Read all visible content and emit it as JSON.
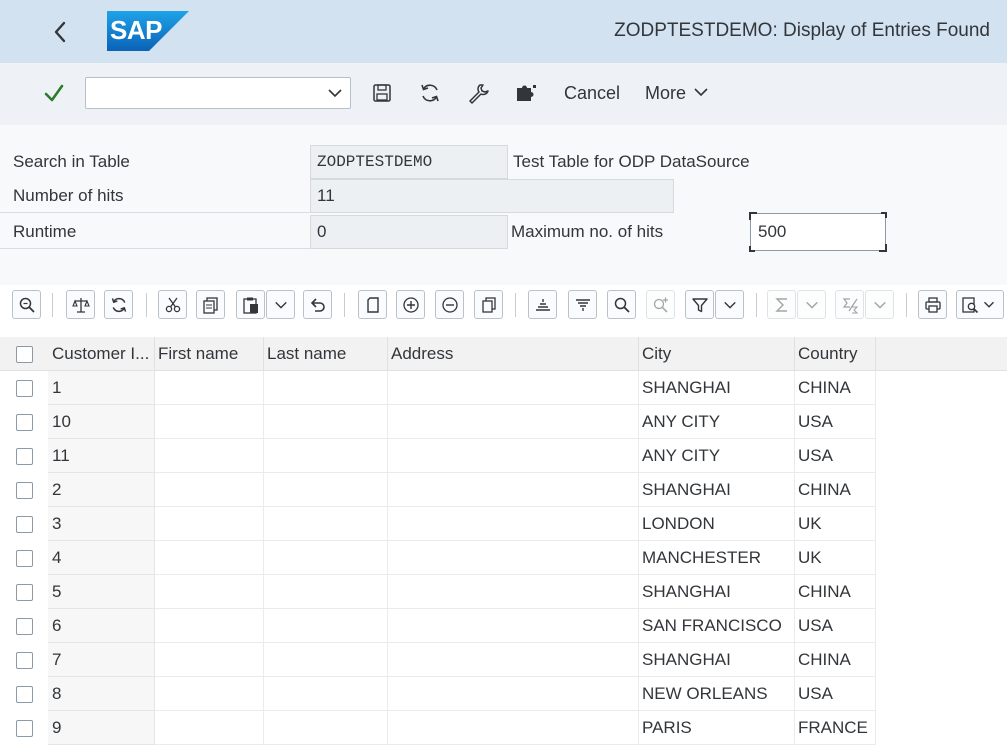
{
  "shell": {
    "title": "ZODPTESTDEMO: Display of Entries Found",
    "logo_text": "SAP"
  },
  "toolbar": {
    "command_value": "",
    "cancel_label": "Cancel",
    "more_label": "More"
  },
  "form": {
    "search_label": "Search in Table",
    "search_value": "ZODPTESTDEMO",
    "table_description": "Test Table for ODP DataSource",
    "hits_label": "Number of hits",
    "hits_value": "11",
    "runtime_label": "Runtime",
    "runtime_value": "0",
    "maxhits_label": "Maximum no. of hits",
    "maxhits_value": "500"
  },
  "grid": {
    "columns": [
      "Customer I...",
      "First name",
      "Last name",
      "Address",
      "City",
      "Country"
    ],
    "rows": [
      {
        "id": "1",
        "first": "",
        "last": "",
        "address": "",
        "city": "SHANGHAI",
        "country": "CHINA"
      },
      {
        "id": "10",
        "first": "",
        "last": "",
        "address": "",
        "city": "ANY CITY",
        "country": "USA"
      },
      {
        "id": "11",
        "first": "",
        "last": "",
        "address": "",
        "city": "ANY CITY",
        "country": "USA"
      },
      {
        "id": "2",
        "first": "",
        "last": "",
        "address": "",
        "city": "SHANGHAI",
        "country": "CHINA"
      },
      {
        "id": "3",
        "first": "",
        "last": "",
        "address": "",
        "city": "LONDON",
        "country": "UK"
      },
      {
        "id": "4",
        "first": "",
        "last": "",
        "address": "",
        "city": "MANCHESTER",
        "country": "UK"
      },
      {
        "id": "5",
        "first": "",
        "last": "",
        "address": "",
        "city": "SHANGHAI",
        "country": "CHINA"
      },
      {
        "id": "6",
        "first": "",
        "last": "",
        "address": "",
        "city": "SAN FRANCISCO",
        "country": "USA"
      },
      {
        "id": "7",
        "first": "",
        "last": "",
        "address": "",
        "city": "SHANGHAI",
        "country": "CHINA"
      },
      {
        "id": "8",
        "first": "",
        "last": "",
        "address": "",
        "city": "NEW ORLEANS",
        "country": "USA"
      },
      {
        "id": "9",
        "first": "",
        "last": "",
        "address": "",
        "city": "PARIS",
        "country": "FRANCE"
      }
    ]
  },
  "colors": {
    "shell_bg": "#d2e2f1",
    "sap_blue": "#1a73c8",
    "ok_green": "#2b7d2b"
  }
}
